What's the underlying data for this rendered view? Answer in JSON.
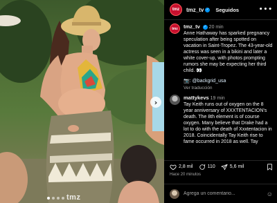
{
  "photo": {
    "watermark": "tmz",
    "next_glyph": "›"
  },
  "header": {
    "avatar_text": "tmz",
    "username": "tmz_tv",
    "verified_glyph": "✓",
    "follow_label": "Seguidos",
    "more_glyph": "•••"
  },
  "comments": [
    {
      "username": "tmz_tv",
      "time": "20 min",
      "text": "Anne Hathaway has sparked pregnancy speculation after being spotted on vacation in Saint-Tropez. The 43-year-old actress was seen in a bikini and later a white cover-up, with photos prompting rumors she may be expecting her third child. 👀",
      "credit_prefix": "📷: ",
      "credit_tag": "@backgrid_usa",
      "translate": "Ver traducción"
    },
    {
      "username": "mattykevs",
      "time": "19 min",
      "text": "Tay Keith runs out of oxygen on the 8 year anniversary of XXXTENTACION's death. The 8th element is of course oxygen. Many believe that Drake had a lot to do with the death of Xxxtentacion in 2018. Coincidentally Tay Keith rise to fame occurred in 2018 as well. Tay"
    }
  ],
  "actions": {
    "likes": "2,8 mil",
    "comments": "110",
    "shares": "5,6 mil"
  },
  "timestamp": "Hace 20 minutos",
  "composer": {
    "placeholder": "Agrega un comentario..."
  }
}
